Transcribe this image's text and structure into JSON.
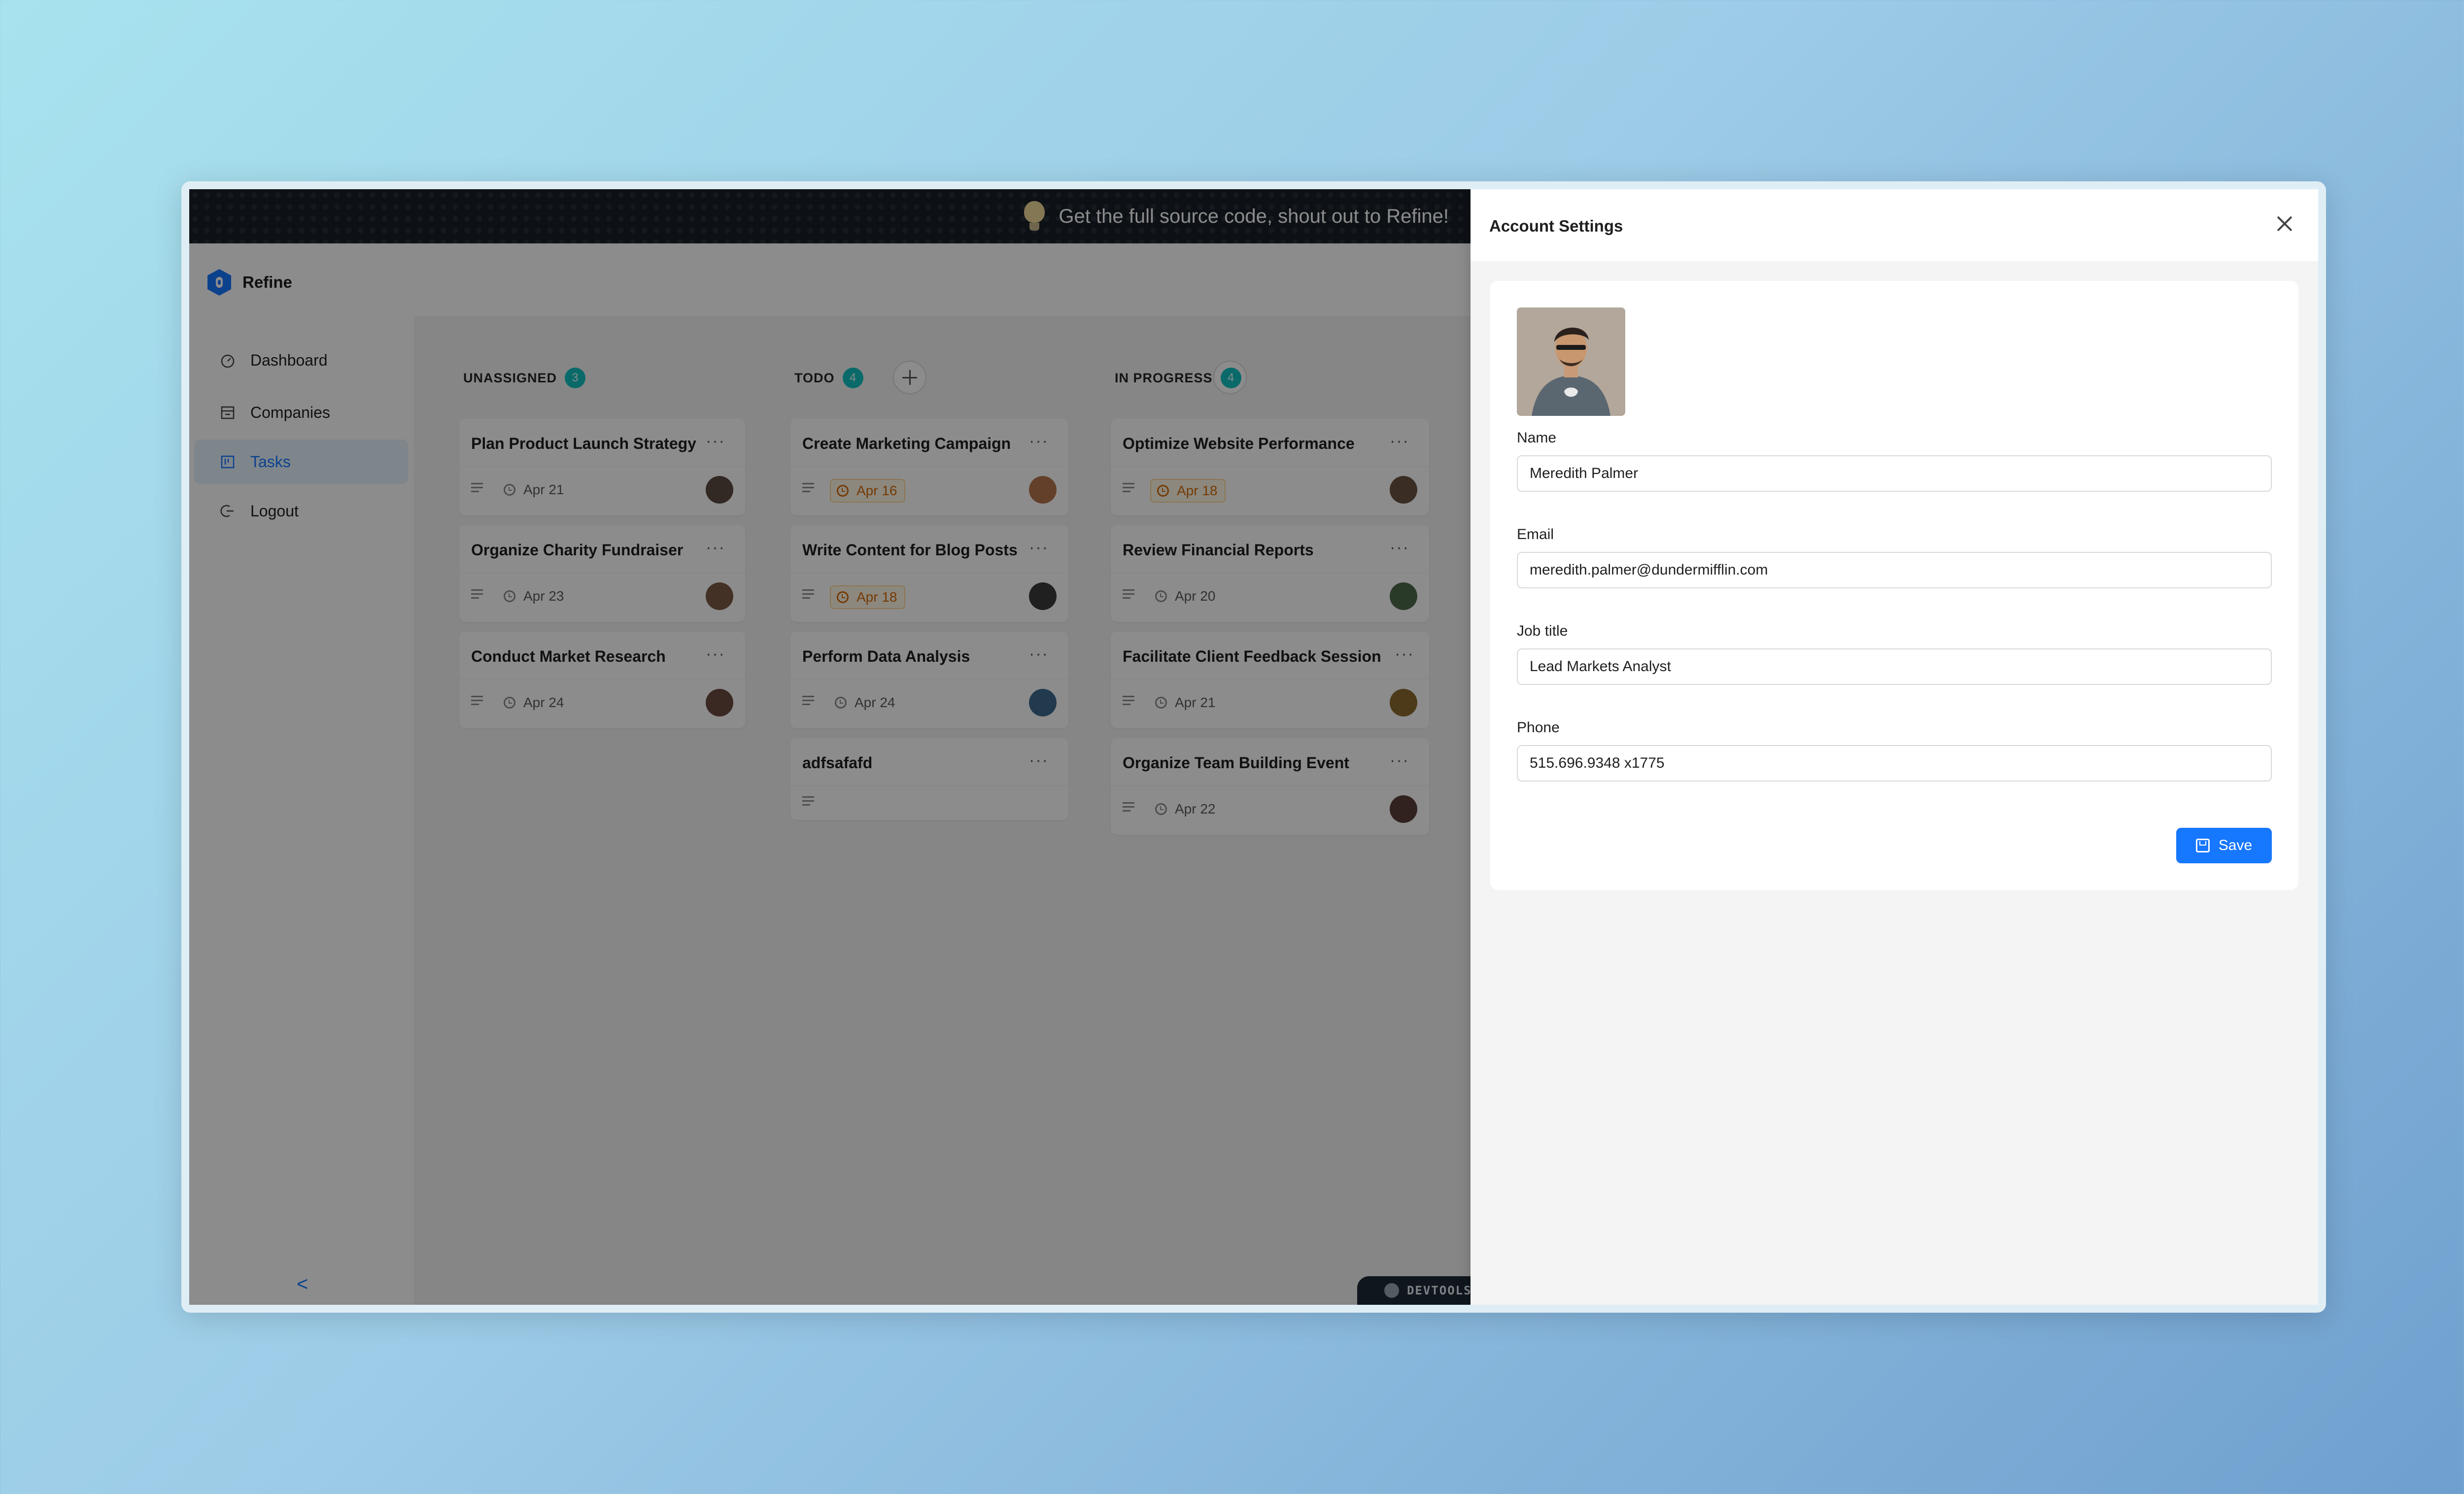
{
  "banner": {
    "text": "Get the full source code, shout out to Refine!"
  },
  "app": {
    "name": "Refine"
  },
  "sidebar": {
    "items": [
      {
        "label": "Dashboard",
        "icon": "dashboard-icon",
        "active": false
      },
      {
        "label": "Companies",
        "icon": "shop-icon",
        "active": false
      },
      {
        "label": "Tasks",
        "icon": "project-icon",
        "active": true
      },
      {
        "label": "Logout",
        "icon": "logout-icon",
        "active": false
      }
    ],
    "collapse_label": "<"
  },
  "board": {
    "columns": [
      {
        "title": "UNASSIGNED",
        "count": "3",
        "cards": [
          {
            "title": "Plan Product Launch Strategy",
            "date": "Apr 21",
            "warn": false,
            "avatar": "#5c4a42"
          },
          {
            "title": "Organize Charity Fundraiser",
            "date": "Apr 23",
            "warn": false,
            "avatar": "#7a5a46"
          },
          {
            "title": "Conduct Market Research",
            "date": "Apr 24",
            "warn": false,
            "avatar": "#6a4a3f"
          }
        ]
      },
      {
        "title": "TODO",
        "count": "4",
        "cards": [
          {
            "title": "Create Marketing Campaign",
            "date": "Apr 16",
            "warn": true,
            "avatar": "#b4754e"
          },
          {
            "title": "Write Content for Blog Posts",
            "date": "Apr 18",
            "warn": true,
            "avatar": "#3b3b3b"
          },
          {
            "title": "Perform Data Analysis",
            "date": "Apr 24",
            "warn": false,
            "avatar": "#3f6a8c"
          },
          {
            "title": "adfsafafd",
            "date": "",
            "warn": false,
            "avatar": ""
          }
        ]
      },
      {
        "title": "IN PROGRESS",
        "count": "4",
        "cards": [
          {
            "title": "Optimize Website Performance",
            "date": "Apr 18",
            "warn": true,
            "avatar": "#6b5240"
          },
          {
            "title": "Review Financial Reports",
            "date": "Apr 20",
            "warn": false,
            "avatar": "#4e6b4a"
          },
          {
            "title": "Facilitate Client Feedback Session",
            "date": "Apr 21",
            "warn": false,
            "avatar": "#8a6a2e"
          },
          {
            "title": "Organize Team Building Event",
            "date": "Apr 22",
            "warn": false,
            "avatar": "#5a3e3a"
          }
        ]
      }
    ]
  },
  "devtools": {
    "label": "DEVTOOLS"
  },
  "drawer": {
    "title": "Account Settings",
    "fields": {
      "name": {
        "label": "Name",
        "value": "Meredith Palmer"
      },
      "email": {
        "label": "Email",
        "value": "meredith.palmer@dundermifflin.com"
      },
      "job_title": {
        "label": "Job title",
        "value": "Lead Markets Analyst"
      },
      "phone": {
        "label": "Phone",
        "value": "515.696.9348 x1775"
      }
    },
    "save_label": "Save"
  },
  "colors": {
    "accent": "#1677ff",
    "badge": "#13c2c2",
    "warning": "#d46b08"
  }
}
